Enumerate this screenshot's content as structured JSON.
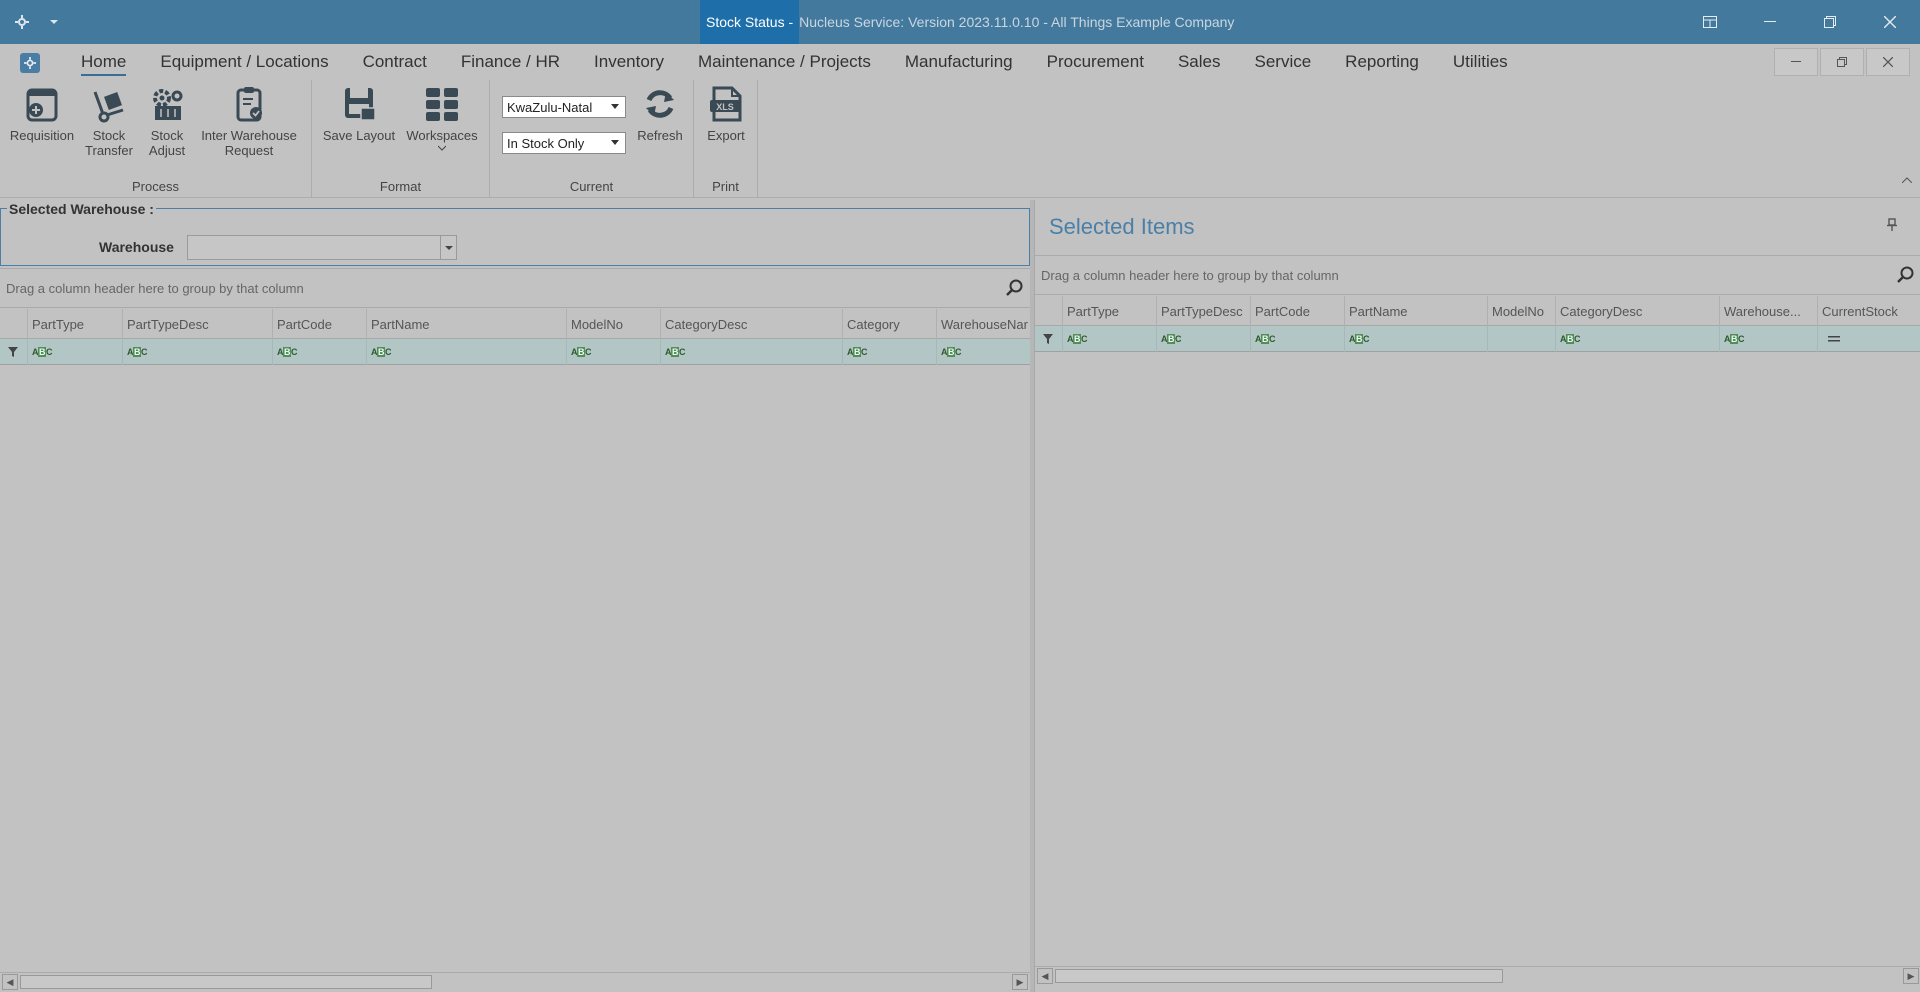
{
  "titlebar": {
    "active_title": "Stock Status -",
    "rest_title": "Nucleus Service: Version 2023.11.0.10 - All Things Example Company",
    "app_icon": "gear-icon",
    "quick_access": "chevron-down-icon"
  },
  "menu": {
    "tabs": [
      "Home",
      "Equipment / Locations",
      "Contract",
      "Finance / HR",
      "Inventory",
      "Maintenance / Projects",
      "Manufacturing",
      "Procurement",
      "Sales",
      "Service",
      "Reporting",
      "Utilities"
    ],
    "active_tab": "Home"
  },
  "ribbon": {
    "groups": {
      "process": "Process",
      "format": "Format",
      "current": "Current",
      "print": "Print"
    },
    "buttons": {
      "requisition": "Requisition",
      "stock_transfer_1": "Stock",
      "stock_transfer_2": "Transfer",
      "stock_adjust_1": "Stock",
      "stock_adjust_2": "Adjust",
      "inter_wh_1": "Inter Warehouse",
      "inter_wh_2": "Request",
      "save_layout": "Save Layout",
      "workspaces": "Workspaces",
      "refresh": "Refresh",
      "export": "Export"
    },
    "region_combo": "KwaZulu-Natal",
    "stock_filter_combo": "In Stock Only"
  },
  "left": {
    "section_title": "Selected Warehouse :",
    "warehouse_label": "Warehouse",
    "group_hint": "Drag a column header here to group by that column",
    "columns": [
      "PartType",
      "PartTypeDesc",
      "PartCode",
      "PartName",
      "ModelNo",
      "CategoryDesc",
      "Category",
      "WarehouseNar"
    ]
  },
  "right": {
    "title": "Selected Items",
    "group_hint": "Drag a column header here to group by that column",
    "columns": [
      "PartType",
      "PartTypeDesc",
      "PartCode",
      "PartName",
      "ModelNo",
      "CategoryDesc",
      "Warehouse...",
      "CurrentStock"
    ]
  }
}
